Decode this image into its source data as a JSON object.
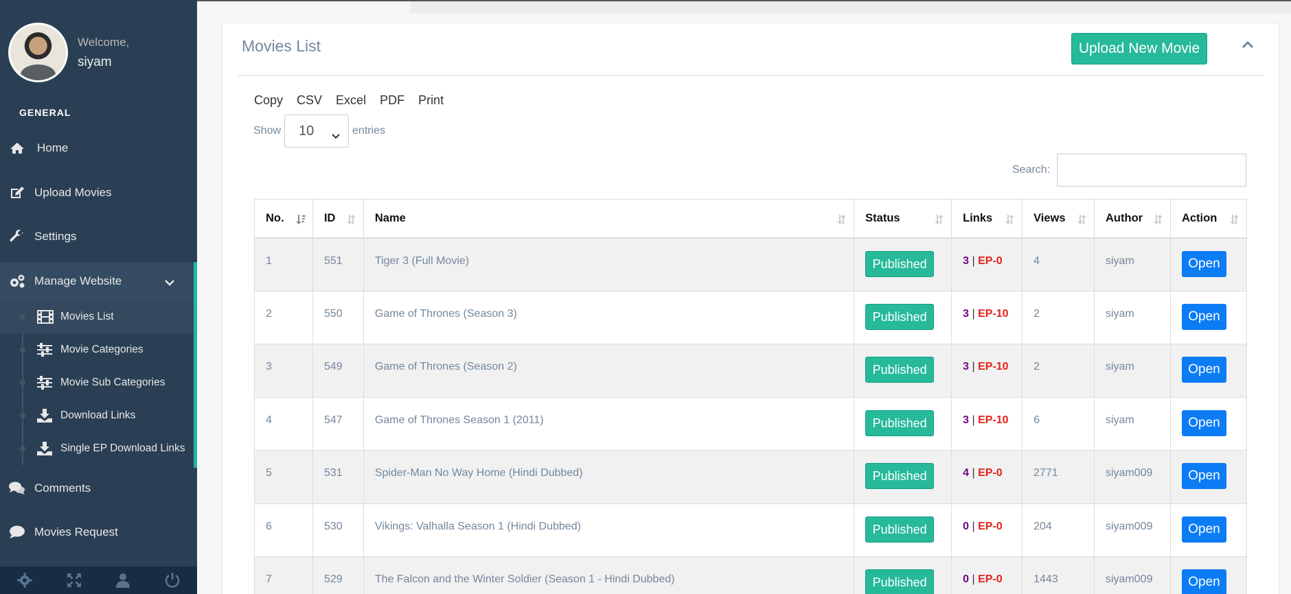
{
  "user": {
    "welcome": "Welcome,",
    "name": "siyam"
  },
  "sidebar": {
    "section_title": "GENERAL",
    "items": [
      {
        "label": "Home",
        "icon": "home-icon"
      },
      {
        "label": "Upload Movies",
        "icon": "edit-icon"
      },
      {
        "label": "Settings",
        "icon": "wrench-icon"
      },
      {
        "label": "Manage Website",
        "icon": "gears-icon"
      },
      {
        "label": "Comments",
        "icon": "comments-icon"
      },
      {
        "label": "Movies Request",
        "icon": "comment-icon"
      }
    ],
    "submenu": [
      {
        "label": "Movies List",
        "icon": "film-icon",
        "active": true
      },
      {
        "label": "Movie Categories",
        "icon": "sliders-icon"
      },
      {
        "label": "Movie Sub Categories",
        "icon": "sliders-icon"
      },
      {
        "label": "Download Links",
        "icon": "download-icon"
      },
      {
        "label": "Single EP Download Links",
        "icon": "download-icon"
      }
    ],
    "footer_icons": [
      "settings-icon",
      "fullscreen-icon",
      "user-icon",
      "power-icon"
    ]
  },
  "panel": {
    "title": "Movies List",
    "upload_label": "Upload New Movie"
  },
  "table_controls": {
    "export_buttons": [
      "Copy",
      "CSV",
      "Excel",
      "PDF",
      "Print"
    ],
    "show_label": "Show",
    "entries_value": "10",
    "entries_label": "entries",
    "search_label": "Search:"
  },
  "table": {
    "headers": [
      "No.",
      "ID",
      "Name",
      "Status",
      "Links",
      "Views",
      "Author",
      "Action"
    ],
    "rows": [
      {
        "no": "1",
        "id": "551",
        "name": "Tiger 3 (Full Movie)",
        "status": "Published",
        "links_n": "3",
        "links_ep": "EP-0",
        "views": "4",
        "author": "siyam",
        "action": "Open"
      },
      {
        "no": "2",
        "id": "550",
        "name": "Game of Thrones (Season 3)",
        "status": "Published",
        "links_n": "3",
        "links_ep": "EP-10",
        "views": "2",
        "author": "siyam",
        "action": "Open"
      },
      {
        "no": "3",
        "id": "549",
        "name": "Game of Thrones (Season 2)",
        "status": "Published",
        "links_n": "3",
        "links_ep": "EP-10",
        "views": "2",
        "author": "siyam",
        "action": "Open"
      },
      {
        "no": "4",
        "id": "547",
        "name": "Game of Thrones Season 1 (2011)",
        "status": "Published",
        "links_n": "3",
        "links_ep": "EP-10",
        "views": "6",
        "author": "siyam",
        "action": "Open"
      },
      {
        "no": "5",
        "id": "531",
        "name": "Spider-Man No Way Home (Hindi Dubbed)",
        "status": "Published",
        "links_n": "4",
        "links_ep": "EP-0",
        "views": "2771",
        "author": "siyam009",
        "action": "Open"
      },
      {
        "no": "6",
        "id": "530",
        "name": "Vikings: Valhalla Season 1 (Hindi Dubbed)",
        "status": "Published",
        "links_n": "0",
        "links_ep": "EP-0",
        "views": "204",
        "author": "siyam009",
        "action": "Open"
      },
      {
        "no": "7",
        "id": "529",
        "name": "The Falcon and the Winter Soldier (Season 1 - Hindi Dubbed)",
        "status": "Published",
        "links_n": "0",
        "links_ep": "EP-0",
        "views": "1443",
        "author": "siyam009",
        "action": "Open"
      }
    ]
  },
  "colors": {
    "sidebar": "#2a3f54",
    "accent": "#26b99a",
    "open": "#0c7cf5"
  }
}
